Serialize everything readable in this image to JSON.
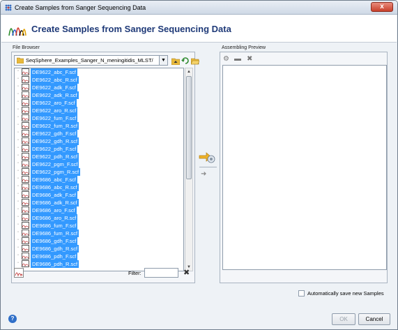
{
  "window": {
    "title": "Create Samples from Sanger Sequencing Data",
    "close_label": "x"
  },
  "header": {
    "title": "Create Samples from Sanger Sequencing Data"
  },
  "file_browser": {
    "label": "File Browser",
    "path": "SeqSphere_Examples_Sanger_N_meningitidis_MLST/",
    "filter_label": "Filter:",
    "filter_value": "",
    "files": [
      "DE9622_abc_F.scf",
      "DE9622_abc_R.scf",
      "DE9622_adk_F.scf",
      "DE9622_adk_R.scf",
      "DE9622_aro_F.scf",
      "DE9622_aro_R.scf",
      "DE9622_fum_F.scf",
      "DE9622_fum_R.scf",
      "DE9622_gdh_F.scf",
      "DE9622_gdh_R.scf",
      "DE9622_pdh_F.scf",
      "DE9622_pdh_R.scf",
      "DE9622_pgm_F.scf",
      "DE9622_pgm_R.scf",
      "DE9686_abc_F.scf",
      "DE9686_abc_R.scf",
      "DE9686_adk_F.scf",
      "DE9686_adk_R.scf",
      "DE9686_aro_F.scf",
      "DE9686_aro_R.scf",
      "DE9686_fum_F.scf",
      "DE9686_fum_R.scf",
      "DE9686_gdh_F.scf",
      "DE9686_gdh_R.scf",
      "DE9686_pdh_F.scf",
      "DE9686_pdh_R.scf"
    ],
    "selected_all": true
  },
  "assembling_preview": {
    "label": "Assembling Preview"
  },
  "options": {
    "autosave_label": "Automatically save new Samples",
    "autosave_checked": false
  },
  "buttons": {
    "ok": "OK",
    "cancel": "Cancel",
    "ok_enabled": false
  },
  "icons": {
    "title": "sequence-app-icon",
    "header": "chromatogram-logo-icon",
    "transfer": "add-to-preview-icon",
    "help": "help-icon"
  },
  "colors": {
    "selection": "#3399ff",
    "header_title": "#1f3a78",
    "close": "#c8402b"
  }
}
